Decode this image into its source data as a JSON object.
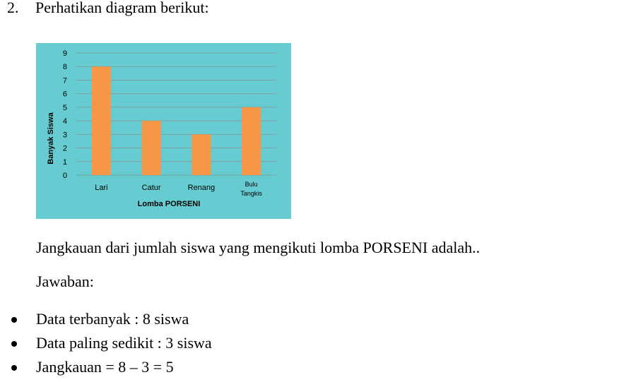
{
  "heading": {
    "number": "2.",
    "text": "Perhatikan diagram berikut:"
  },
  "question": "Jangkauan dari jumlah siswa yang mengikuti lomba PORSENI adalah..",
  "answer_label": "Jawaban:",
  "bullets": [
    {
      "text": "Data terbanyak : 8 siswa"
    },
    {
      "text": "Data paling sedikit : 3 siswa"
    },
    {
      "text": "Jangkauan = 8 – 3 = 5"
    }
  ],
  "chart_data": {
    "type": "bar",
    "categories": [
      "Lari",
      "Catur",
      "Renang",
      "Bulu Tangkis"
    ],
    "values": [
      8,
      4,
      3,
      5
    ],
    "title": "",
    "xlabel": "Lomba PORSENI",
    "ylabel": "Banyak Siswa",
    "ylim": [
      0,
      9
    ],
    "yticks": [
      0,
      1,
      2,
      3,
      4,
      5,
      6,
      7,
      8,
      9
    ],
    "grid": true,
    "colors": {
      "background": "#66CCD1",
      "bar": "#F79646",
      "grid": "#7F9FA0"
    }
  }
}
